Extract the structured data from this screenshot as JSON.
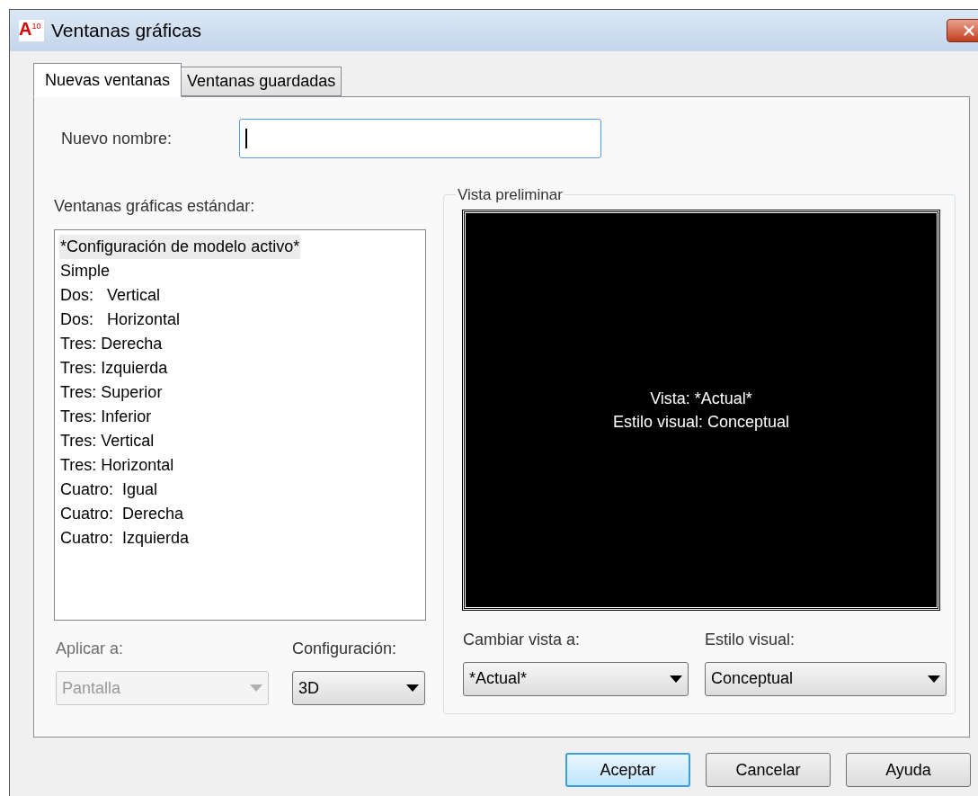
{
  "window": {
    "title": "Ventanas gráficas",
    "app_icon": {
      "letter": "A",
      "version": "10"
    }
  },
  "tabs": [
    {
      "label": "Nuevas ventanas",
      "selected": true
    },
    {
      "label": "Ventanas guardadas",
      "selected": false
    }
  ],
  "new_name": {
    "label": "Nuevo nombre:",
    "focused": true
  },
  "standard_viewports": {
    "label": "Ventanas gráficas estándar:",
    "items": [
      {
        "label": "*Configuración de modelo activo*",
        "selected": true
      },
      {
        "label": "Simple",
        "selected": false
      },
      {
        "label": "Dos:   Vertical",
        "selected": false
      },
      {
        "label": "Dos:   Horizontal",
        "selected": false
      },
      {
        "label": "Tres: Derecha",
        "selected": false
      },
      {
        "label": "Tres: Izquierda",
        "selected": false
      },
      {
        "label": "Tres: Superior",
        "selected": false
      },
      {
        "label": "Tres: Inferior",
        "selected": false
      },
      {
        "label": "Tres: Vertical",
        "selected": false
      },
      {
        "label": "Tres: Horizontal",
        "selected": false
      },
      {
        "label": "Cuatro:  Igual",
        "selected": false
      },
      {
        "label": "Cuatro:  Derecha",
        "selected": false
      },
      {
        "label": "Cuatro:  Izquierda",
        "selected": false
      }
    ]
  },
  "apply_to": {
    "label": "Aplicar a:",
    "value": "Pantalla",
    "disabled": true
  },
  "setup": {
    "label": "Configuración:",
    "value": "3D",
    "disabled": false
  },
  "preview": {
    "title": "Vista preliminar",
    "lines": [
      "Vista: *Actual*",
      "Estilo visual: Conceptual"
    ],
    "change_view": {
      "label": "Cambiar vista a:",
      "value": "*Actual*",
      "disabled": false
    },
    "visual_style": {
      "label": "Estilo visual:",
      "value": "Conceptual",
      "disabled": false
    }
  },
  "buttons": [
    {
      "label": "Aceptar",
      "default": true
    },
    {
      "label": "Cancelar",
      "default": false
    },
    {
      "label": "Ayuda",
      "default": false
    }
  ]
}
